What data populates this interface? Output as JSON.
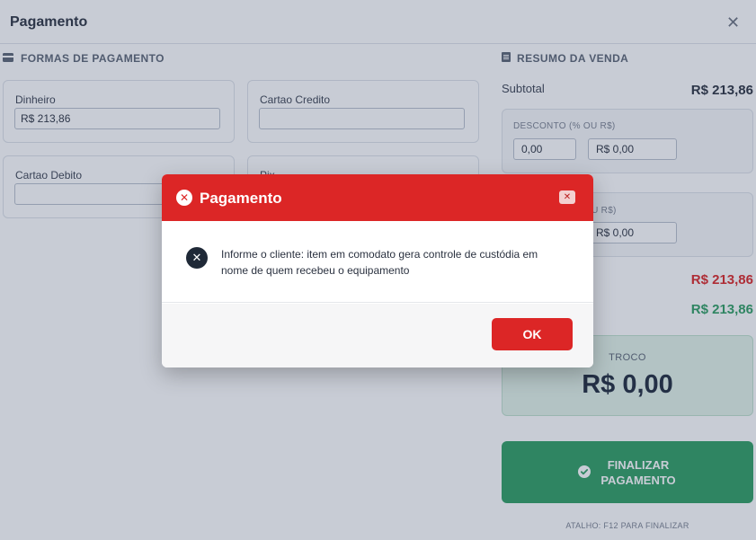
{
  "window": {
    "title": "Pagamento",
    "close_symbol": "✕"
  },
  "payment_methods": {
    "section_title": "FORMAS DE PAGAMENTO",
    "icon": "credit-card-icon",
    "methods": [
      {
        "label": "Dinheiro",
        "value": "R$ 213,86"
      },
      {
        "label": "Cartao Credito",
        "value": ""
      },
      {
        "label": "Cartao Debito",
        "value": ""
      },
      {
        "label": "Pix",
        "value": ""
      }
    ]
  },
  "summary": {
    "section_title": "RESUMO DA VENDA",
    "icon": "receipt-icon",
    "subtotal_label": "Subtotal",
    "subtotal_value": "R$ 213,86",
    "discount_label": "DESCONTO (% OU R$)",
    "discount_percent": "0,00",
    "discount_value": "R$ 0,00",
    "second_box_label_fragment": "OU R$)",
    "second_box_value": "R$ 0,00",
    "total_red": "R$ 213,86",
    "total_green": "R$ 213,86",
    "troco_label": "TROCO",
    "troco_value": "R$ 0,00",
    "finalize_label": "FINALIZAR PAGAMENTO",
    "shortcut": "ATALHO: F12 PARA FINALIZAR"
  },
  "colors": {
    "danger": "#dc2626",
    "success": "#2e9e62",
    "overlay": "rgba(51,65,100,0.27)"
  },
  "dialog": {
    "title": "Pagamento",
    "header_icon": "error-circle-icon",
    "close_symbol": "✕",
    "message_icon": "error-icon",
    "message": "Informe o cliente: item em comodato gera controle de custódia em nome de quem recebeu o equipamento",
    "ok_label": "OK"
  }
}
